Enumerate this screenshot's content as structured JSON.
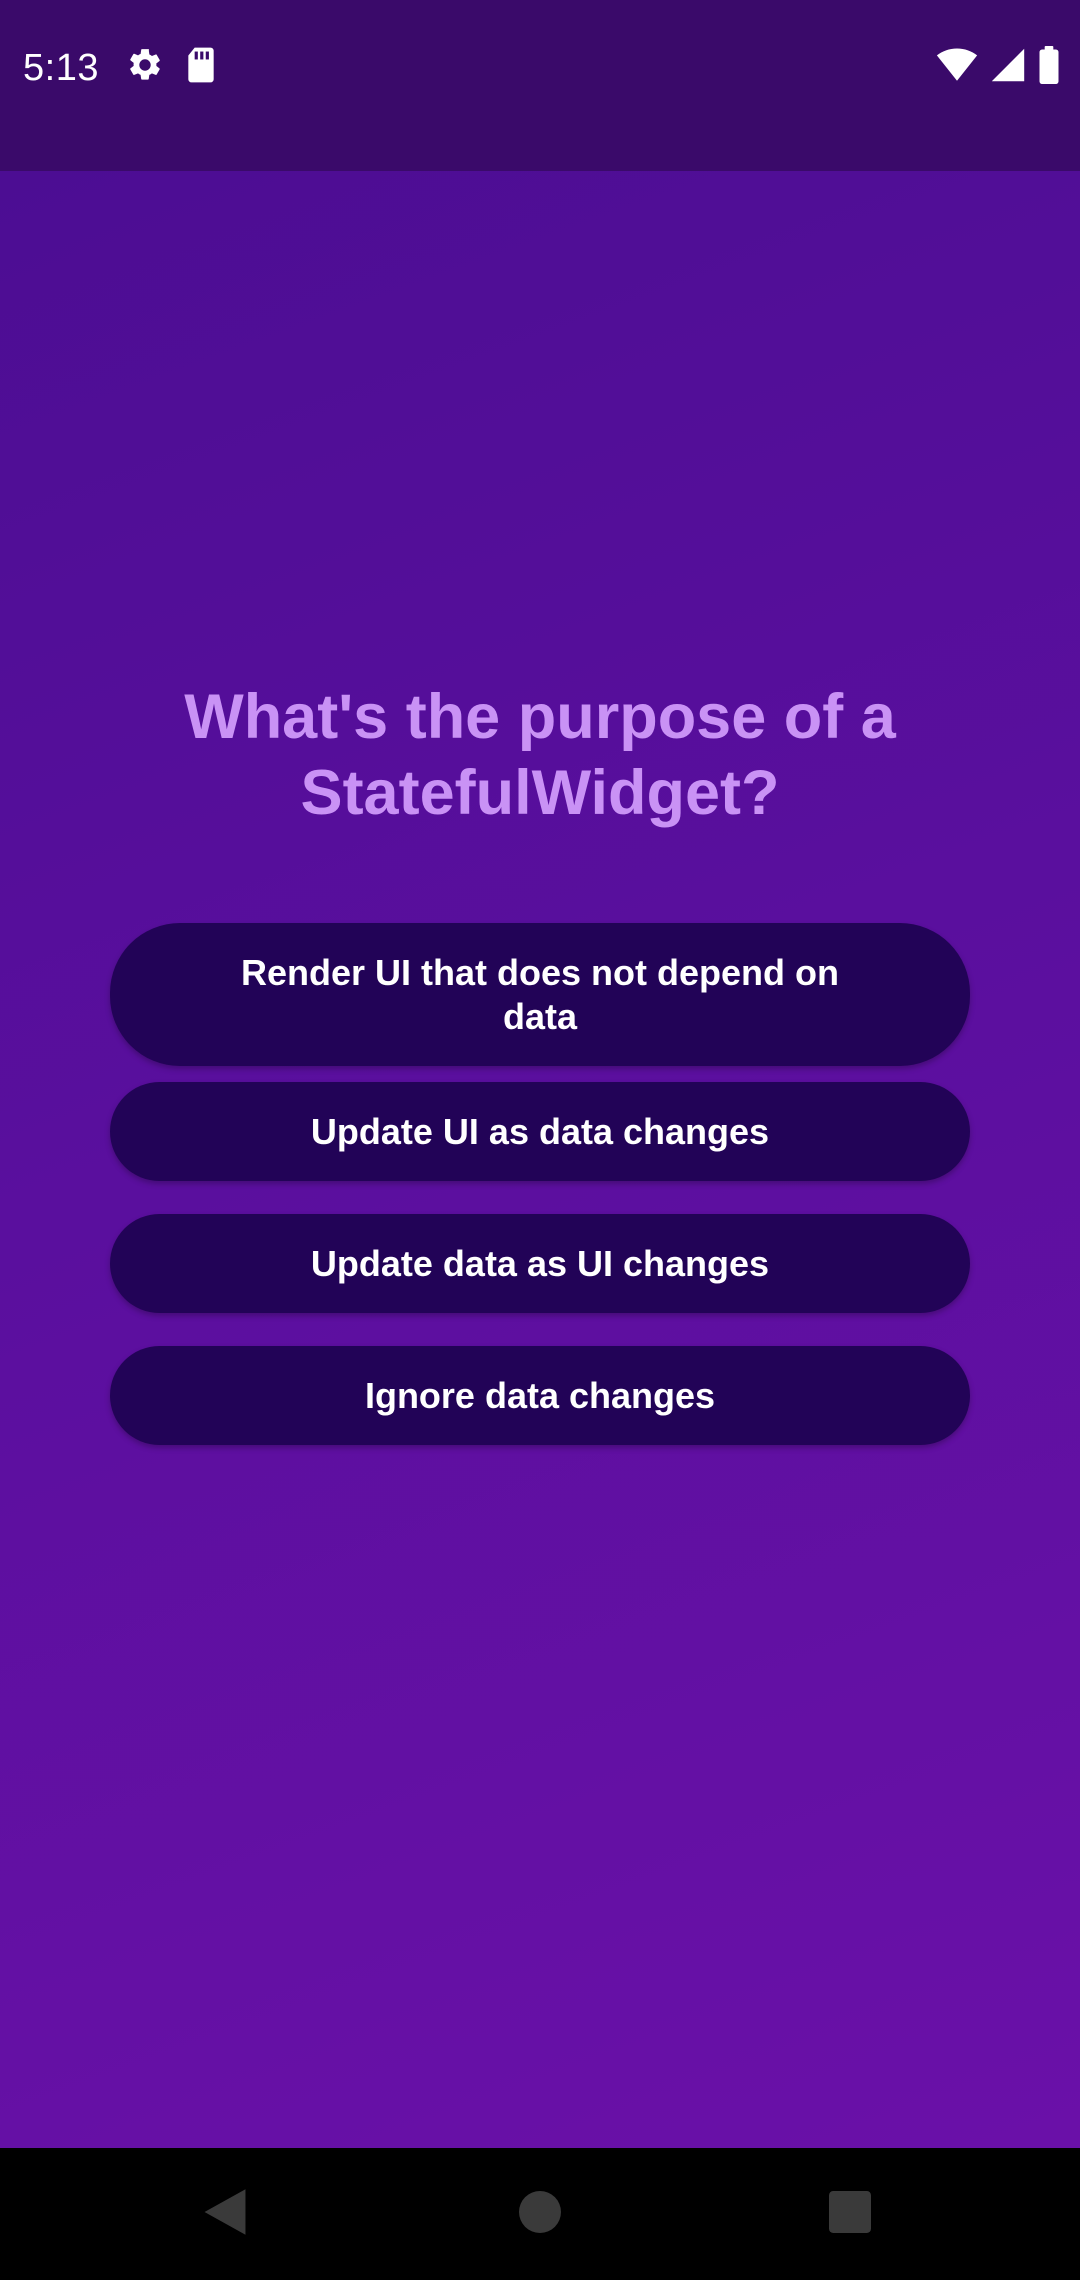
{
  "status_bar": {
    "time": "5:13",
    "left_icons": [
      "settings-gear-icon",
      "sd-card-icon"
    ],
    "right_icons": [
      "wifi-icon",
      "cell-signal-icon",
      "battery-icon"
    ]
  },
  "quiz": {
    "question": "What's the purpose of a StatefulWidget?",
    "answers": [
      "Render UI that does not depend on data",
      "Update UI as data changes",
      "Update data as UI changes",
      "Ignore data changes"
    ]
  },
  "nav_bar": {
    "icons": [
      "back-icon",
      "home-icon",
      "recents-icon"
    ]
  },
  "colors": {
    "background": "#5a0f9e",
    "status_bar": "#3a0a6a",
    "question_text": "#c992f5",
    "button_bg": "#220357",
    "button_text": "#ffffff",
    "nav_bar": "#000000"
  }
}
